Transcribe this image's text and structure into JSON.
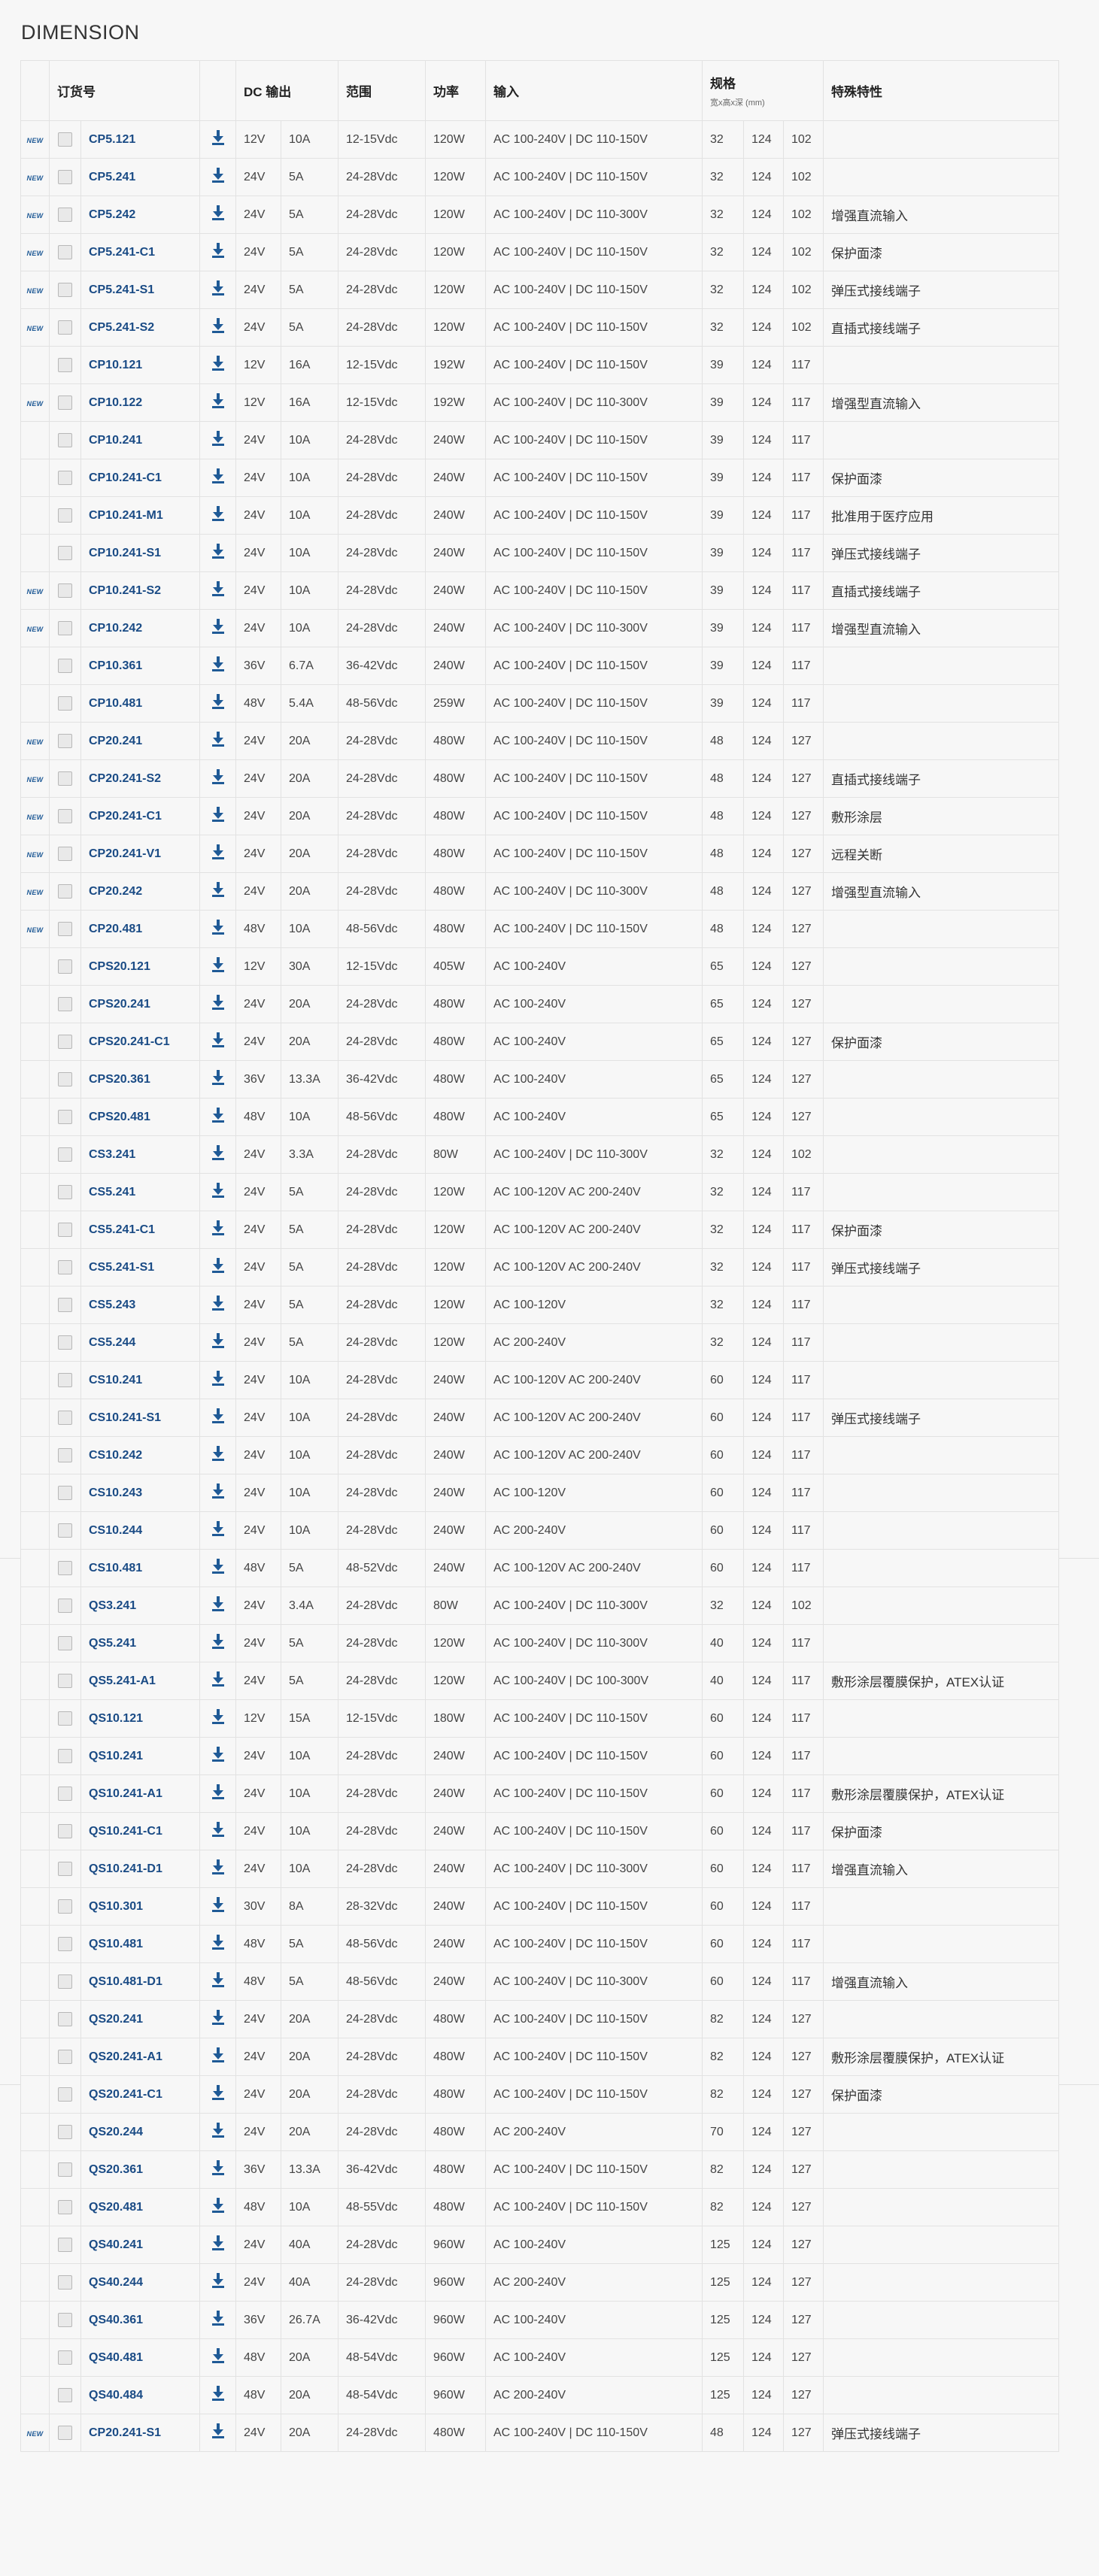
{
  "page": {
    "title": "DIMENSION"
  },
  "header": {
    "order": "订货号",
    "dc_output": "DC 输出",
    "range": "范围",
    "power": "功率",
    "input": "输入",
    "spec": "规格",
    "spec_sub": "宽x高x深 (mm)",
    "features": "特殊特性"
  },
  "new_label": "NEW",
  "icons": {
    "download": "download-icon",
    "checkbox": "checkbox"
  },
  "colors": {
    "link": "#1a4b85",
    "icon": "#1f5a96",
    "border": "#e2e2e2",
    "background": "#f7f7f7"
  },
  "rows": [
    {
      "new": "NEW",
      "order": "CP5.121",
      "v": "12V",
      "a": "10A",
      "range": "12-15Vdc",
      "power": "120W",
      "input": "AC 100-240V | DC 110-150V",
      "w": "32",
      "h": "124",
      "d": "102",
      "feature": ""
    },
    {
      "new": "NEW",
      "order": "CP5.241",
      "v": "24V",
      "a": "5A",
      "range": "24-28Vdc",
      "power": "120W",
      "input": "AC 100-240V | DC 110-150V",
      "w": "32",
      "h": "124",
      "d": "102",
      "feature": ""
    },
    {
      "new": "NEW",
      "order": "CP5.242",
      "v": "24V",
      "a": "5A",
      "range": "24-28Vdc",
      "power": "120W",
      "input": "AC 100-240V | DC 110-300V",
      "w": "32",
      "h": "124",
      "d": "102",
      "feature": "增强直流输入"
    },
    {
      "new": "NEW",
      "order": "CP5.241-C1",
      "v": "24V",
      "a": "5A",
      "range": "24-28Vdc",
      "power": "120W",
      "input": "AC 100-240V | DC 110-150V",
      "w": "32",
      "h": "124",
      "d": "102",
      "feature": "保护面漆"
    },
    {
      "new": "NEW",
      "order": "CP5.241-S1",
      "v": "24V",
      "a": "5A",
      "range": "24-28Vdc",
      "power": "120W",
      "input": "AC 100-240V | DC 110-150V",
      "w": "32",
      "h": "124",
      "d": "102",
      "feature": "弹压式接线端子"
    },
    {
      "new": "NEW",
      "order": "CP5.241-S2",
      "v": "24V",
      "a": "5A",
      "range": "24-28Vdc",
      "power": "120W",
      "input": "AC 100-240V | DC 110-150V",
      "w": "32",
      "h": "124",
      "d": "102",
      "feature": "直插式接线端子"
    },
    {
      "new": "",
      "order": "CP10.121",
      "v": "12V",
      "a": "16A",
      "range": "12-15Vdc",
      "power": "192W",
      "input": "AC 100-240V | DC 110-150V",
      "w": "39",
      "h": "124",
      "d": "117",
      "feature": ""
    },
    {
      "new": "NEW",
      "order": "CP10.122",
      "v": "12V",
      "a": "16A",
      "range": "12-15Vdc",
      "power": "192W",
      "input": "AC 100-240V | DC 110-300V",
      "w": "39",
      "h": "124",
      "d": "117",
      "feature": "增强型直流输入"
    },
    {
      "new": "",
      "order": "CP10.241",
      "v": "24V",
      "a": "10A",
      "range": "24-28Vdc",
      "power": "240W",
      "input": "AC 100-240V | DC 110-150V",
      "w": "39",
      "h": "124",
      "d": "117",
      "feature": ""
    },
    {
      "new": "",
      "order": "CP10.241-C1",
      "v": "24V",
      "a": "10A",
      "range": "24-28Vdc",
      "power": "240W",
      "input": "AC 100-240V | DC 110-150V",
      "w": "39",
      "h": "124",
      "d": "117",
      "feature": "保护面漆"
    },
    {
      "new": "",
      "order": "CP10.241-M1",
      "v": "24V",
      "a": "10A",
      "range": "24-28Vdc",
      "power": "240W",
      "input": "AC 100-240V | DC 110-150V",
      "w": "39",
      "h": "124",
      "d": "117",
      "feature": "批准用于医疗应用"
    },
    {
      "new": "",
      "order": "CP10.241-S1",
      "v": "24V",
      "a": "10A",
      "range": "24-28Vdc",
      "power": "240W",
      "input": "AC 100-240V | DC 110-150V",
      "w": "39",
      "h": "124",
      "d": "117",
      "feature": "弹压式接线端子"
    },
    {
      "new": "NEW",
      "order": "CP10.241-S2",
      "v": "24V",
      "a": "10A",
      "range": "24-28Vdc",
      "power": "240W",
      "input": "AC 100-240V | DC 110-150V",
      "w": "39",
      "h": "124",
      "d": "117",
      "feature": "直插式接线端子"
    },
    {
      "new": "NEW",
      "order": "CP10.242",
      "v": "24V",
      "a": "10A",
      "range": "24-28Vdc",
      "power": "240W",
      "input": "AC 100-240V | DC 110-300V",
      "w": "39",
      "h": "124",
      "d": "117",
      "feature": "增强型直流输入"
    },
    {
      "new": "",
      "order": "CP10.361",
      "v": "36V",
      "a": "6.7A",
      "range": "36-42Vdc",
      "power": "240W",
      "input": "AC 100-240V | DC 110-150V",
      "w": "39",
      "h": "124",
      "d": "117",
      "feature": ""
    },
    {
      "new": "",
      "order": "CP10.481",
      "v": "48V",
      "a": "5.4A",
      "range": "48-56Vdc",
      "power": "259W",
      "input": "AC 100-240V | DC 110-150V",
      "w": "39",
      "h": "124",
      "d": "117",
      "feature": ""
    },
    {
      "new": "NEW",
      "order": "CP20.241",
      "v": "24V",
      "a": "20A",
      "range": "24-28Vdc",
      "power": "480W",
      "input": "AC 100-240V | DC 110-150V",
      "w": "48",
      "h": "124",
      "d": "127",
      "feature": ""
    },
    {
      "new": "NEW",
      "order": "CP20.241-S2",
      "v": "24V",
      "a": "20A",
      "range": "24-28Vdc",
      "power": "480W",
      "input": "AC 100-240V | DC 110-150V",
      "w": "48",
      "h": "124",
      "d": "127",
      "feature": "直插式接线端子"
    },
    {
      "new": "NEW",
      "order": "CP20.241-C1",
      "v": "24V",
      "a": "20A",
      "range": "24-28Vdc",
      "power": "480W",
      "input": "AC 100-240V | DC 110-150V",
      "w": "48",
      "h": "124",
      "d": "127",
      "feature": "敷形涂层"
    },
    {
      "new": "NEW",
      "order": "CP20.241-V1",
      "v": "24V",
      "a": "20A",
      "range": "24-28Vdc",
      "power": "480W",
      "input": "AC 100-240V | DC 110-150V",
      "w": "48",
      "h": "124",
      "d": "127",
      "feature": "远程关断"
    },
    {
      "new": "NEW",
      "order": "CP20.242",
      "v": "24V",
      "a": "20A",
      "range": "24-28Vdc",
      "power": "480W",
      "input": "AC 100-240V | DC 110-300V",
      "w": "48",
      "h": "124",
      "d": "127",
      "feature": "增强型直流输入"
    },
    {
      "new": "NEW",
      "order": "CP20.481",
      "v": "48V",
      "a": "10A",
      "range": "48-56Vdc",
      "power": "480W",
      "input": "AC 100-240V | DC 110-150V",
      "w": "48",
      "h": "124",
      "d": "127",
      "feature": ""
    },
    {
      "new": "",
      "order": "CPS20.121",
      "v": "12V",
      "a": "30A",
      "range": "12-15Vdc",
      "power": "405W",
      "input": "AC 100-240V",
      "w": "65",
      "h": "124",
      "d": "127",
      "feature": ""
    },
    {
      "new": "",
      "order": "CPS20.241",
      "v": "24V",
      "a": "20A",
      "range": "24-28Vdc",
      "power": "480W",
      "input": "AC 100-240V",
      "w": "65",
      "h": "124",
      "d": "127",
      "feature": ""
    },
    {
      "new": "",
      "order": "CPS20.241-C1",
      "v": "24V",
      "a": "20A",
      "range": "24-28Vdc",
      "power": "480W",
      "input": "AC 100-240V",
      "w": "65",
      "h": "124",
      "d": "127",
      "feature": "保护面漆"
    },
    {
      "new": "",
      "order": "CPS20.361",
      "v": "36V",
      "a": "13.3A",
      "range": "36-42Vdc",
      "power": "480W",
      "input": "AC 100-240V",
      "w": "65",
      "h": "124",
      "d": "127",
      "feature": ""
    },
    {
      "new": "",
      "order": "CPS20.481",
      "v": "48V",
      "a": "10A",
      "range": "48-56Vdc",
      "power": "480W",
      "input": "AC 100-240V",
      "w": "65",
      "h": "124",
      "d": "127",
      "feature": ""
    },
    {
      "new": "",
      "order": "CS3.241",
      "v": "24V",
      "a": "3.3A",
      "range": "24-28Vdc",
      "power": "80W",
      "input": "AC 100-240V | DC 110-300V",
      "w": "32",
      "h": "124",
      "d": "102",
      "feature": ""
    },
    {
      "new": "",
      "order": "CS5.241",
      "v": "24V",
      "a": "5A",
      "range": "24-28Vdc",
      "power": "120W",
      "input": "AC 100-120V AC 200-240V",
      "w": "32",
      "h": "124",
      "d": "117",
      "feature": ""
    },
    {
      "new": "",
      "order": "CS5.241-C1",
      "v": "24V",
      "a": "5A",
      "range": "24-28Vdc",
      "power": "120W",
      "input": "AC 100-120V AC 200-240V",
      "w": "32",
      "h": "124",
      "d": "117",
      "feature": "保护面漆"
    },
    {
      "new": "",
      "order": "CS5.241-S1",
      "v": "24V",
      "a": "5A",
      "range": "24-28Vdc",
      "power": "120W",
      "input": "AC 100-120V AC 200-240V",
      "w": "32",
      "h": "124",
      "d": "117",
      "feature": "弹压式接线端子"
    },
    {
      "new": "",
      "order": "CS5.243",
      "v": "24V",
      "a": "5A",
      "range": "24-28Vdc",
      "power": "120W",
      "input": "AC 100-120V",
      "w": "32",
      "h": "124",
      "d": "117",
      "feature": ""
    },
    {
      "new": "",
      "order": "CS5.244",
      "v": "24V",
      "a": "5A",
      "range": "24-28Vdc",
      "power": "120W",
      "input": "AC 200-240V",
      "w": "32",
      "h": "124",
      "d": "117",
      "feature": ""
    },
    {
      "new": "",
      "order": "CS10.241",
      "v": "24V",
      "a": "10A",
      "range": "24-28Vdc",
      "power": "240W",
      "input": "AC 100-120V AC 200-240V",
      "w": "60",
      "h": "124",
      "d": "117",
      "feature": ""
    },
    {
      "new": "",
      "order": "CS10.241-S1",
      "v": "24V",
      "a": "10A",
      "range": "24-28Vdc",
      "power": "240W",
      "input": "AC 100-120V AC 200-240V",
      "w": "60",
      "h": "124",
      "d": "117",
      "feature": "弹压式接线端子"
    },
    {
      "new": "",
      "order": "CS10.242",
      "v": "24V",
      "a": "10A",
      "range": "24-28Vdc",
      "power": "240W",
      "input": "AC 100-120V AC 200-240V",
      "w": "60",
      "h": "124",
      "d": "117",
      "feature": ""
    },
    {
      "new": "",
      "order": "CS10.243",
      "v": "24V",
      "a": "10A",
      "range": "24-28Vdc",
      "power": "240W",
      "input": "AC 100-120V",
      "w": "60",
      "h": "124",
      "d": "117",
      "feature": ""
    },
    {
      "new": "",
      "order": "CS10.244",
      "v": "24V",
      "a": "10A",
      "range": "24-28Vdc",
      "power": "240W",
      "input": "AC 200-240V",
      "w": "60",
      "h": "124",
      "d": "117",
      "feature": ""
    },
    {
      "new": "",
      "order": "CS10.481",
      "v": "48V",
      "a": "5A",
      "range": "48-52Vdc",
      "power": "240W",
      "input": "AC 100-120V AC 200-240V",
      "w": "60",
      "h": "124",
      "d": "117",
      "feature": ""
    },
    {
      "new": "",
      "order": "QS3.241",
      "v": "24V",
      "a": "3.4A",
      "range": "24-28Vdc",
      "power": "80W",
      "input": "AC 100-240V | DC 110-300V",
      "w": "32",
      "h": "124",
      "d": "102",
      "feature": ""
    },
    {
      "new": "",
      "order": "QS5.241",
      "v": "24V",
      "a": "5A",
      "range": "24-28Vdc",
      "power": "120W",
      "input": "AC 100-240V | DC 110-300V",
      "w": "40",
      "h": "124",
      "d": "117",
      "feature": ""
    },
    {
      "new": "",
      "order": "QS5.241-A1",
      "v": "24V",
      "a": "5A",
      "range": "24-28Vdc",
      "power": "120W",
      "input": "AC 100-240V | DC 100-300V",
      "w": "40",
      "h": "124",
      "d": "117",
      "feature": "敷形涂层覆膜保护，ATEX认证"
    },
    {
      "new": "",
      "order": "QS10.121",
      "v": "12V",
      "a": "15A",
      "range": "12-15Vdc",
      "power": "180W",
      "input": "AC 100-240V | DC 110-150V",
      "w": "60",
      "h": "124",
      "d": "117",
      "feature": ""
    },
    {
      "new": "",
      "order": "QS10.241",
      "v": "24V",
      "a": "10A",
      "range": "24-28Vdc",
      "power": "240W",
      "input": "AC 100-240V | DC 110-150V",
      "w": "60",
      "h": "124",
      "d": "117",
      "feature": ""
    },
    {
      "new": "",
      "order": "QS10.241-A1",
      "v": "24V",
      "a": "10A",
      "range": "24-28Vdc",
      "power": "240W",
      "input": "AC 100-240V | DC 110-150V",
      "w": "60",
      "h": "124",
      "d": "117",
      "feature": "敷形涂层覆膜保护，ATEX认证"
    },
    {
      "new": "",
      "order": "QS10.241-C1",
      "v": "24V",
      "a": "10A",
      "range": "24-28Vdc",
      "power": "240W",
      "input": "AC 100-240V | DC 110-150V",
      "w": "60",
      "h": "124",
      "d": "117",
      "feature": "保护面漆"
    },
    {
      "new": "",
      "order": "QS10.241-D1",
      "v": "24V",
      "a": "10A",
      "range": "24-28Vdc",
      "power": "240W",
      "input": "AC 100-240V | DC 110-300V",
      "w": "60",
      "h": "124",
      "d": "117",
      "feature": "增强直流输入"
    },
    {
      "new": "",
      "order": "QS10.301",
      "v": "30V",
      "a": "8A",
      "range": "28-32Vdc",
      "power": "240W",
      "input": "AC 100-240V | DC 110-150V",
      "w": "60",
      "h": "124",
      "d": "117",
      "feature": ""
    },
    {
      "new": "",
      "order": "QS10.481",
      "v": "48V",
      "a": "5A",
      "range": "48-56Vdc",
      "power": "240W",
      "input": "AC 100-240V | DC 110-150V",
      "w": "60",
      "h": "124",
      "d": "117",
      "feature": ""
    },
    {
      "new": "",
      "order": "QS10.481-D1",
      "v": "48V",
      "a": "5A",
      "range": "48-56Vdc",
      "power": "240W",
      "input": "AC 100-240V | DC 110-300V",
      "w": "60",
      "h": "124",
      "d": "117",
      "feature": "增强直流输入"
    },
    {
      "new": "",
      "order": "QS20.241",
      "v": "24V",
      "a": "20A",
      "range": "24-28Vdc",
      "power": "480W",
      "input": "AC 100-240V | DC 110-150V",
      "w": "82",
      "h": "124",
      "d": "127",
      "feature": ""
    },
    {
      "new": "",
      "order": "QS20.241-A1",
      "v": "24V",
      "a": "20A",
      "range": "24-28Vdc",
      "power": "480W",
      "input": "AC 100-240V | DC 110-150V",
      "w": "82",
      "h": "124",
      "d": "127",
      "feature": "敷形涂层覆膜保护，ATEX认证"
    },
    {
      "new": "",
      "order": "QS20.241-C1",
      "v": "24V",
      "a": "20A",
      "range": "24-28Vdc",
      "power": "480W",
      "input": "AC 100-240V | DC 110-150V",
      "w": "82",
      "h": "124",
      "d": "127",
      "feature": "保护面漆"
    },
    {
      "new": "",
      "order": "QS20.244",
      "v": "24V",
      "a": "20A",
      "range": "24-28Vdc",
      "power": "480W",
      "input": "AC 200-240V",
      "w": "70",
      "h": "124",
      "d": "127",
      "feature": ""
    },
    {
      "new": "",
      "order": "QS20.361",
      "v": "36V",
      "a": "13.3A",
      "range": "36-42Vdc",
      "power": "480W",
      "input": "AC 100-240V | DC 110-150V",
      "w": "82",
      "h": "124",
      "d": "127",
      "feature": ""
    },
    {
      "new": "",
      "order": "QS20.481",
      "v": "48V",
      "a": "10A",
      "range": "48-55Vdc",
      "power": "480W",
      "input": "AC 100-240V | DC 110-150V",
      "w": "82",
      "h": "124",
      "d": "127",
      "feature": ""
    },
    {
      "new": "",
      "order": "QS40.241",
      "v": "24V",
      "a": "40A",
      "range": "24-28Vdc",
      "power": "960W",
      "input": "AC 100-240V",
      "w": "125",
      "h": "124",
      "d": "127",
      "feature": ""
    },
    {
      "new": "",
      "order": "QS40.244",
      "v": "24V",
      "a": "40A",
      "range": "24-28Vdc",
      "power": "960W",
      "input": "AC 200-240V",
      "w": "125",
      "h": "124",
      "d": "127",
      "feature": ""
    },
    {
      "new": "",
      "order": "QS40.361",
      "v": "36V",
      "a": "26.7A",
      "range": "36-42Vdc",
      "power": "960W",
      "input": "AC 100-240V",
      "w": "125",
      "h": "124",
      "d": "127",
      "feature": ""
    },
    {
      "new": "",
      "order": "QS40.481",
      "v": "48V",
      "a": "20A",
      "range": "48-54Vdc",
      "power": "960W",
      "input": "AC 100-240V",
      "w": "125",
      "h": "124",
      "d": "127",
      "feature": ""
    },
    {
      "new": "",
      "order": "QS40.484",
      "v": "48V",
      "a": "20A",
      "range": "48-54Vdc",
      "power": "960W",
      "input": "AC 200-240V",
      "w": "125",
      "h": "124",
      "d": "127",
      "feature": ""
    },
    {
      "new": "NEW",
      "order": "CP20.241-S1",
      "v": "24V",
      "a": "20A",
      "range": "24-28Vdc",
      "power": "480W",
      "input": "AC 100-240V | DC 110-150V",
      "w": "48",
      "h": "124",
      "d": "127",
      "feature": "弹压式接线端子"
    }
  ]
}
